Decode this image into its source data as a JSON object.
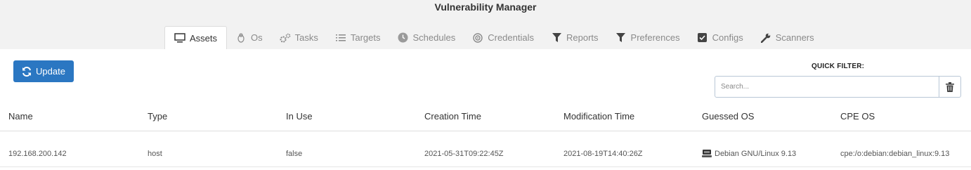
{
  "app": {
    "title": "Vulnerability Manager"
  },
  "tabs": [
    {
      "label": "Assets",
      "icon": "monitor-icon",
      "active": true
    },
    {
      "label": "Os",
      "icon": "linux-icon",
      "active": false
    },
    {
      "label": "Tasks",
      "icon": "cogs-icon",
      "active": false
    },
    {
      "label": "Targets",
      "icon": "list-icon",
      "active": false
    },
    {
      "label": "Schedules",
      "icon": "clock-icon",
      "active": false
    },
    {
      "label": "Credentials",
      "icon": "target-icon",
      "active": false
    },
    {
      "label": "Reports",
      "icon": "filter-icon",
      "active": false
    },
    {
      "label": "Preferences",
      "icon": "filter-icon",
      "active": false
    },
    {
      "label": "Configs",
      "icon": "checkbox-icon",
      "active": false
    },
    {
      "label": "Scanners",
      "icon": "wrench-icon",
      "active": false
    }
  ],
  "toolbar": {
    "update_label": "Update",
    "update_icon": "sync-icon"
  },
  "quick_filter": {
    "label": "QUICK FILTER:",
    "placeholder": "Search...",
    "value": "",
    "clear_icon": "trash-icon"
  },
  "table": {
    "headers": [
      "Name",
      "Type",
      "In Use",
      "Creation Time",
      "Modification Time",
      "Guessed OS",
      "CPE OS"
    ],
    "rows": [
      {
        "name": "192.168.200.142",
        "type": "host",
        "in_use": "false",
        "creation_time": "2021-05-31T09:22:45Z",
        "modification_time": "2021-08-19T14:40:26Z",
        "guessed_os": "Debian GNU/Linux 9.13",
        "guessed_os_icon": "debian-host-icon",
        "cpe_os": "cpe:/o:debian:debian_linux:9.13"
      }
    ]
  },
  "colors": {
    "accent": "#2b77c2",
    "header_band": "#f2f2f2",
    "tab_inactive_text": "#8a8a8a"
  }
}
